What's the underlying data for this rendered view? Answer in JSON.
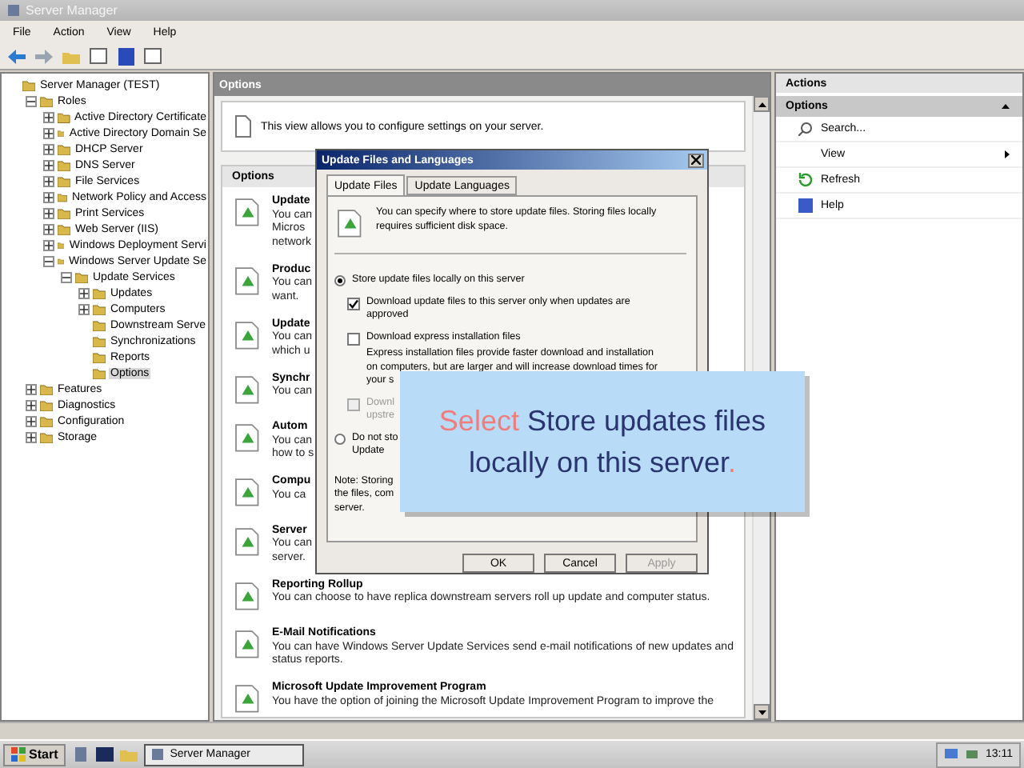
{
  "window": {
    "title": "Server Manager"
  },
  "menu": [
    "File",
    "Action",
    "View",
    "Help"
  ],
  "tree": [
    {
      "label": "Server Manager (TEST)",
      "selected": false,
      "children": [
        {
          "label": "Roles",
          "expanded": true,
          "selected": false,
          "children": [
            {
              "label": "Active Directory Certificate",
              "expanded": false,
              "selected": false
            },
            {
              "label": "Active Directory Domain Se",
              "expanded": false,
              "selected": false
            },
            {
              "label": "DHCP Server",
              "expanded": false,
              "selected": false
            },
            {
              "label": "DNS Server",
              "expanded": false,
              "selected": false
            },
            {
              "label": "File Services",
              "expanded": false,
              "selected": false
            },
            {
              "label": "Network Policy and Access",
              "expanded": false,
              "selected": false
            },
            {
              "label": "Print Services",
              "expanded": false,
              "selected": false
            },
            {
              "label": "Web Server (IIS)",
              "expanded": false,
              "selected": false
            },
            {
              "label": "Windows Deployment Servi",
              "expanded": false,
              "selected": false
            },
            {
              "label": "Windows Server Update Se",
              "expanded": true,
              "selected": false,
              "children": [
                {
                  "label": "Update Services",
                  "expanded": true,
                  "selected": false,
                  "children": [
                    {
                      "label": "Updates",
                      "expanded": false,
                      "selected": false
                    },
                    {
                      "label": "Computers",
                      "expanded": false,
                      "selected": false
                    },
                    {
                      "label": "Downstream Serve",
                      "selected": false
                    },
                    {
                      "label": "Synchronizations",
                      "selected": false
                    },
                    {
                      "label": "Reports",
                      "selected": false
                    },
                    {
                      "label": "Options",
                      "selected": true
                    }
                  ]
                }
              ]
            }
          ]
        },
        {
          "label": "Features",
          "expanded": false,
          "selected": false
        },
        {
          "label": "Diagnostics",
          "expanded": false,
          "selected": false
        },
        {
          "label": "Configuration",
          "expanded": false,
          "selected": false
        },
        {
          "label": "Storage",
          "expanded": false,
          "selected": false
        }
      ]
    }
  ],
  "center": {
    "header": "Options",
    "intro": "This view allows you to configure settings on your server.",
    "list_header": "Options",
    "items": [
      {
        "title": "Update",
        "lines": [
          "You can",
          "Micros",
          "network"
        ]
      },
      {
        "title": "Produc",
        "lines": [
          "You can",
          "want."
        ]
      },
      {
        "title": "Update",
        "lines": [
          "You can",
          "which u"
        ]
      },
      {
        "title": "Synchr",
        "lines": [
          "You can"
        ]
      },
      {
        "title": "Autom",
        "lines": [
          "You can",
          "how to s"
        ]
      },
      {
        "title": "Compu",
        "lines": [
          "You ca"
        ]
      },
      {
        "title": "Server",
        "lines": [
          "You can",
          "server."
        ]
      },
      {
        "title": "Reporting Rollup",
        "lines": [
          "You can choose to have replica downstream servers roll up update and computer status."
        ]
      },
      {
        "title": "E-Mail Notifications",
        "lines": [
          "You can have Windows Server Update Services send e-mail notifications of new updates and",
          "status reports."
        ]
      },
      {
        "title": "Microsoft Update Improvement Program",
        "lines": [
          "You have the option of joining the Microsoft Update Improvement Program to improve the"
        ]
      }
    ]
  },
  "dialog": {
    "title": "Update Files and Languages",
    "tabs": [
      {
        "label": "Update Files",
        "selected": true
      },
      {
        "label": "Update Languages",
        "selected": false
      }
    ],
    "info": [
      "You can specify where to store update files. Storing files locally",
      "requires sufficient disk space."
    ],
    "options": [
      {
        "kind": "radio",
        "selected": true,
        "lines": [
          "Store update files locally on this server"
        ]
      },
      {
        "kind": "checkbox",
        "checked": true,
        "disabled": false,
        "lines": [
          "Download update files to this server only when updates are",
          "approved"
        ]
      },
      {
        "kind": "checkbox",
        "checked": false,
        "disabled": false,
        "lines": [
          "Download express installation files"
        ],
        "desc": [
          "Express installation files provide faster download and installation",
          "on computers, but are larger and will increase download times for",
          "your s"
        ]
      },
      {
        "kind": "checkbox",
        "checked": false,
        "disabled": true,
        "lines": [
          "Downl",
          "upstre"
        ]
      },
      {
        "kind": "radio",
        "selected": false,
        "lines": [
          "Do not sto",
          "Update"
        ]
      }
    ],
    "note": [
      "Note: Storing",
      "the files, com",
      "server."
    ],
    "buttons": [
      {
        "label": "OK",
        "disabled": false
      },
      {
        "label": "Cancel",
        "disabled": false
      },
      {
        "label": "Apply",
        "disabled": true
      }
    ]
  },
  "callout": {
    "action": "Select",
    "target": "Store updates files locally on this server",
    "end": "."
  },
  "actions": {
    "header": "Actions",
    "section": "Options",
    "items": [
      {
        "label": "Search...",
        "kind": "search"
      },
      {
        "label": "View",
        "kind": "submenu"
      },
      {
        "label": "Refresh",
        "kind": "refresh"
      },
      {
        "label": "Help",
        "kind": "help"
      }
    ]
  },
  "taskbar": {
    "start": "Start",
    "tasks": [
      {
        "label": "Server Manager",
        "selected": true
      }
    ],
    "clock": "13:11"
  }
}
